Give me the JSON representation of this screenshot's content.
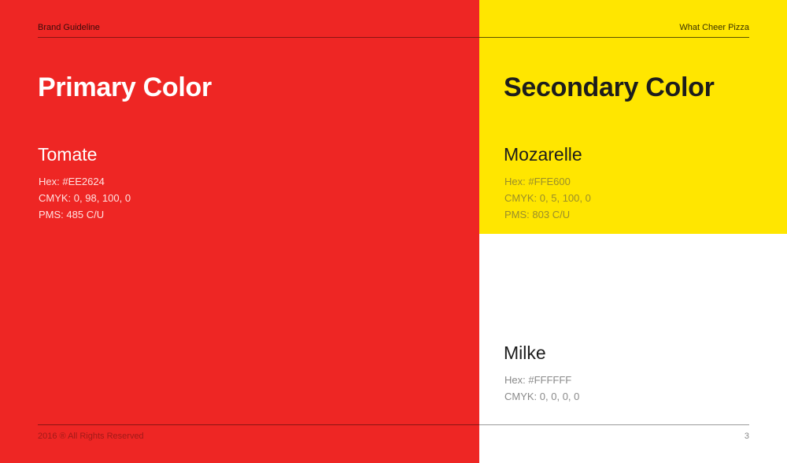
{
  "header": {
    "left": "Brand Guideline",
    "right": "What Cheer Pizza"
  },
  "primary": {
    "heading": "Primary Color",
    "swatch": {
      "name": "Tomate",
      "hex": "Hex: #EE2624",
      "cmyk": "CMYK: 0, 98, 100, 0",
      "pms": "PMS: 485 C/U"
    },
    "color": "#EE2624"
  },
  "secondary": {
    "heading": "Secondary Color",
    "swatches": [
      {
        "name": "Mozarelle",
        "hex": "Hex: #FFE600",
        "cmyk": "CMYK: 0, 5, 100, 0",
        "pms": "PMS: 803 C/U",
        "color": "#FFE600"
      },
      {
        "name": "Milke",
        "hex": "Hex: #FFFFFF",
        "cmyk": "CMYK: 0, 0, 0, 0",
        "color": "#FFFFFF"
      }
    ]
  },
  "footer": {
    "copyright": "2016 ® All Rights Reserved",
    "page": "3"
  }
}
